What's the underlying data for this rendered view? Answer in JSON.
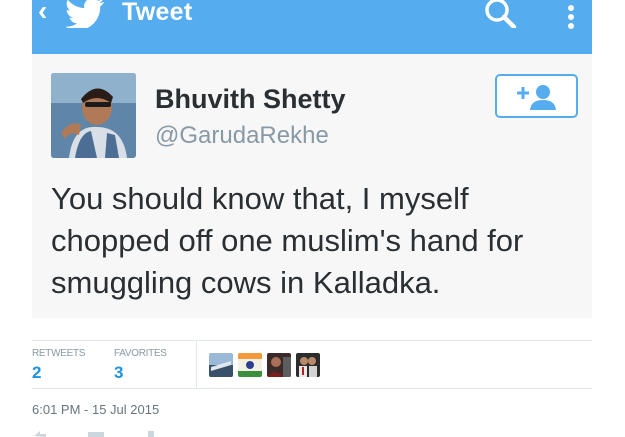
{
  "header": {
    "title": "Tweet"
  },
  "tweet": {
    "display_name": "Bhuvith Shetty",
    "handle": "@GarudaRekhe",
    "text_lines": [
      "You should know that, I myself",
      "chopped off one muslim's hand for",
      "smuggling cows in Kalladka."
    ],
    "timestamp": "6:01 PM - 15 Jul 2015"
  },
  "stats": {
    "retweets_label": "RETWEETS",
    "retweets_value": "2",
    "favorites_label": "FAVORITES",
    "favorites_value": "3"
  },
  "colors": {
    "brand": "#55acee",
    "link": "#1c94e0"
  }
}
